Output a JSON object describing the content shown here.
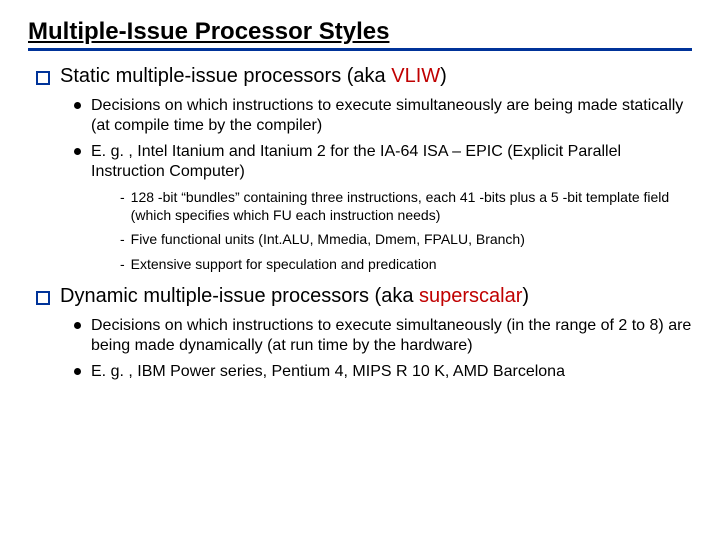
{
  "title": "Multiple-Issue Processor Styles",
  "section1": {
    "head_pre": "Static multiple-issue processors (aka ",
    "head_red": "VLIW",
    "head_post": ")",
    "b1": "Decisions on which instructions to execute simultaneously are being made statically (at compile time by the compiler)",
    "b2": "E. g. , Intel Itanium and Itanium 2 for the IA-64 ISA – EPIC (Explicit Parallel Instruction Computer)",
    "s1": "128 -bit “bundles” containing three instructions, each 41 -bits plus a 5 -bit template field (which specifies which FU each instruction needs)",
    "s2": "Five functional units (Int.ALU, Mmedia, Dmem, FPALU, Branch)",
    "s3": "Extensive support for speculation and predication"
  },
  "section2": {
    "head_pre": "Dynamic multiple-issue processors (aka ",
    "head_red": "superscalar",
    "head_post": ")",
    "b1": "Decisions on which instructions to execute simultaneously (in the range of 2 to 8)  are being made dynamically (at run time by the hardware)",
    "b2": "E. g. , IBM Power series, Pentium 4, MIPS R 10 K, AMD Barcelona"
  }
}
